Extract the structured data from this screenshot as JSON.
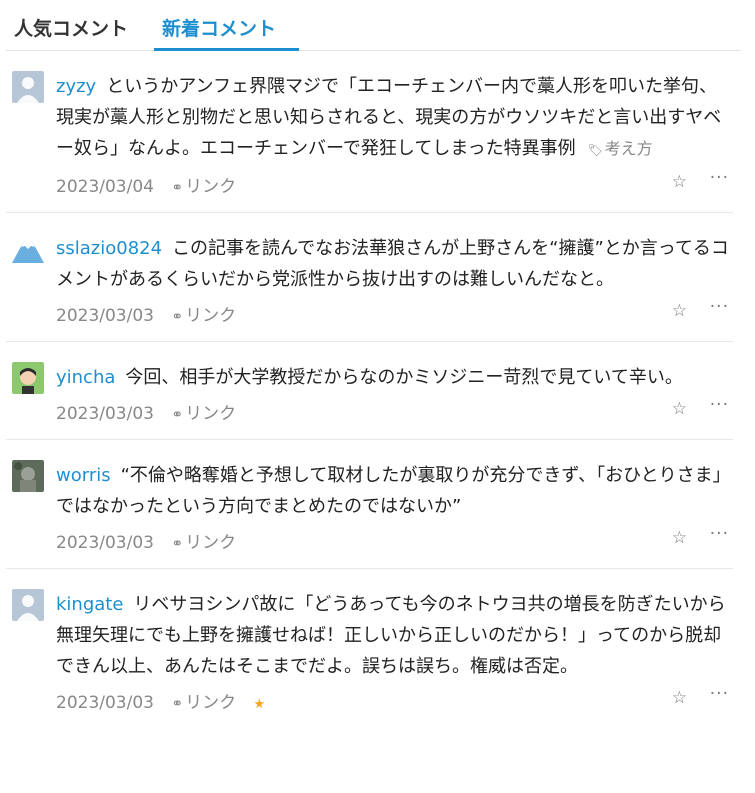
{
  "tabs": {
    "popular": "人気コメント",
    "new": "新着コメント"
  },
  "link_label": "リンク",
  "colors": {
    "accent": "#1d8fd0",
    "star": "#f5a623"
  },
  "comments": [
    {
      "user": "zyzy",
      "text": "というかアンフェ界隈マジで「エコーチェンバー内で藁人形を叩いた挙句、現実が藁人形と別物だと思い知らされると、現実の方がウソツキだと言い出すヤベー奴ら」なんよ。エコーチェンバーで発狂してしまった特異事例",
      "tag": "考え方",
      "date": "2023/03/04",
      "avatar": "default-avatar-icon"
    },
    {
      "user": "sslazio0824",
      "text": "この記事を読んでなお法華狼さんが上野さんを“擁護”とか言ってるコメントがあるくらいだから党派性から抜け出すのは難しいんだなと。",
      "date": "2023/03/03",
      "avatar": "mountain-avatar-icon"
    },
    {
      "user": "yincha",
      "text": "今回、相手が大学教授だからなのかミソジニー苛烈で見ていて辛い。",
      "date": "2023/03/03",
      "avatar": "person-avatar-icon"
    },
    {
      "user": "worris",
      "text": "“不倫や略奪婚と予想して取材したが裏取りが充分できず、「おひとりさま」ではなかったという方向でまとめたのではないか”",
      "date": "2023/03/03",
      "avatar": "photo-avatar-icon"
    },
    {
      "user": "kingate",
      "text": "リベサヨシンパ故に「どうあっても今のネトウヨ共の増長を防ぎたいから無理矢理にでも上野を擁護せねば！正しいから正しいのだから！」ってのから脱却できん以上、あんたはそこまでだよ。誤ちは誤ち。権威は否定。",
      "date": "2023/03/03",
      "avatar": "default-avatar-icon",
      "starred": true
    }
  ]
}
